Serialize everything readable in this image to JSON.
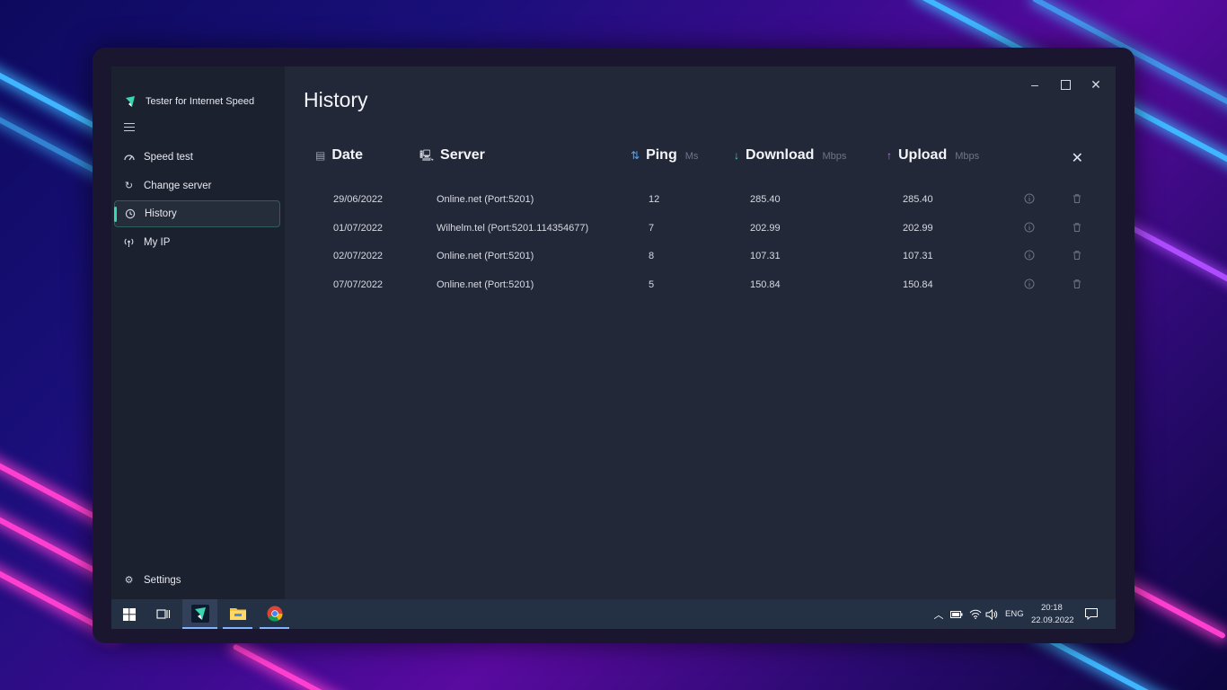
{
  "app": {
    "title": "Tester for Internet Speed"
  },
  "nav": {
    "items": [
      {
        "label": "Speed test",
        "icon": "speedometer-icon"
      },
      {
        "label": "Change server",
        "icon": "refresh-icon"
      },
      {
        "label": "History",
        "icon": "history-icon",
        "active": true
      },
      {
        "label": "My IP",
        "icon": "broadcast-icon"
      }
    ],
    "settings_label": "Settings"
  },
  "page": {
    "title": "History"
  },
  "table": {
    "columns": {
      "date": {
        "label": "Date"
      },
      "server": {
        "label": "Server"
      },
      "ping": {
        "label": "Ping",
        "unit": "Ms"
      },
      "download": {
        "label": "Download",
        "unit": "Mbps"
      },
      "upload": {
        "label": "Upload",
        "unit": "Mbps"
      }
    },
    "rows": [
      {
        "date": "29/06/2022",
        "server": "Online.net (Port:5201)",
        "ping": "12",
        "download": "285.40",
        "upload": "285.40"
      },
      {
        "date": "01/07/2022",
        "server": "Wilhelm.tel (Port:5201.114354677)",
        "ping": "7",
        "download": "202.99",
        "upload": "202.99"
      },
      {
        "date": "02/07/2022",
        "server": "Online.net (Port:5201)",
        "ping": "8",
        "download": "107.31",
        "upload": "107.31"
      },
      {
        "date": "07/07/2022",
        "server": "Online.net (Port:5201)",
        "ping": "5",
        "download": "150.84",
        "upload": "150.84"
      }
    ]
  },
  "taskbar": {
    "language": "ENG",
    "time": "20:18",
    "date": "22.09.2022"
  },
  "colors": {
    "accent": "#3ad6b0",
    "ping_icon": "#4aa8ff",
    "download_icon": "#3ad6b0",
    "upload_icon": "#c86bff"
  }
}
